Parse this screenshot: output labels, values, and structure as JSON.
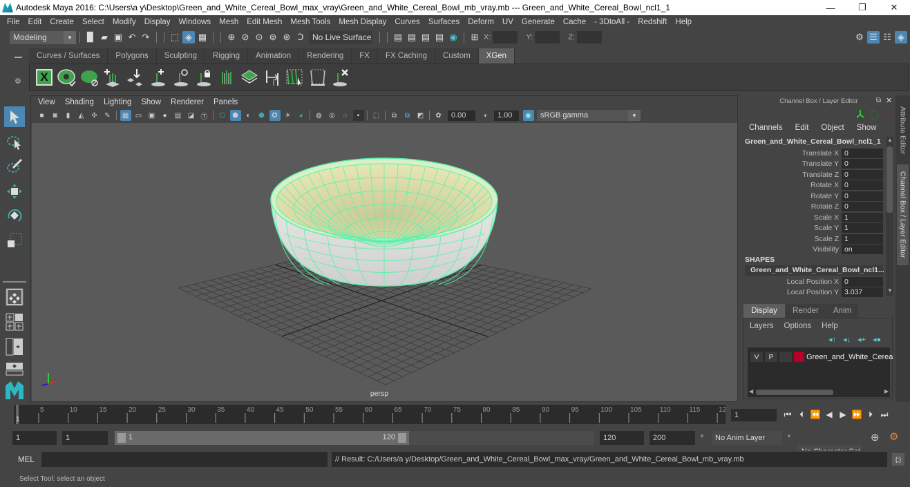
{
  "window": {
    "title": "Autodesk Maya 2016: C:\\Users\\a y\\Desktop\\Green_and_White_Cereal_Bowl_max_vray\\Green_and_White_Cereal_Bowl_mb_vray.mb   ---   Green_and_White_Cereal_Bowl_ncl1_1",
    "minimize": "—",
    "maximize": "❐",
    "close": "✕"
  },
  "menubar": [
    "File",
    "Edit",
    "Create",
    "Select",
    "Modify",
    "Display",
    "Windows",
    "Mesh",
    "Edit Mesh",
    "Mesh Tools",
    "Mesh Display",
    "Curves",
    "Surfaces",
    "Deform",
    "UV",
    "Generate",
    "Cache",
    "- 3DtoAll -",
    "Redshift",
    "Help"
  ],
  "statusline": {
    "mode": "Modeling",
    "live_surface": "No Live Surface",
    "x_label": "X:",
    "y_label": "Y:",
    "z_label": "Z:",
    "x_value": "",
    "y_value": "",
    "z_value": ""
  },
  "shelf": {
    "tabs": [
      "Curves / Surfaces",
      "Polygons",
      "Sculpting",
      "Rigging",
      "Animation",
      "Rendering",
      "FX",
      "FX Caching",
      "Custom",
      "XGen"
    ],
    "active_tab": "XGen",
    "icons": [
      "xgen-library-icon",
      "xgen-preview-icon",
      "xgen-clear-preview-icon",
      "add-guides-icon",
      "place-guides-icon",
      "add-modifier-icon",
      "show-guides-icon",
      "lock-guides-icon",
      "sculpt-guides-icon",
      "convert-to-polygons-icon",
      "rebuild-guides-icon",
      "select-guides-icon",
      "guide-tool-icon",
      "delete-guides-icon"
    ]
  },
  "panel": {
    "menu": [
      "View",
      "Shading",
      "Lighting",
      "Show",
      "Renderer",
      "Panels"
    ],
    "exposure": "0.00",
    "gamma": "1.00",
    "color_space": "sRGB gamma",
    "camera_label": "persp"
  },
  "channel_box": {
    "title": "Channel Box / Layer Editor",
    "menu": [
      "Channels",
      "Edit",
      "Object",
      "Show"
    ],
    "object_name": "Green_and_White_Cereal_Bowl_ncl1_1",
    "attributes": [
      {
        "label": "Translate X",
        "value": "0"
      },
      {
        "label": "Translate Y",
        "value": "0"
      },
      {
        "label": "Translate Z",
        "value": "0"
      },
      {
        "label": "Rotate X",
        "value": "0"
      },
      {
        "label": "Rotate Y",
        "value": "0"
      },
      {
        "label": "Rotate Z",
        "value": "0"
      },
      {
        "label": "Scale X",
        "value": "1"
      },
      {
        "label": "Scale Y",
        "value": "1"
      },
      {
        "label": "Scale Z",
        "value": "1"
      },
      {
        "label": "Visibility",
        "value": "on"
      }
    ],
    "shapes_header": "SHAPES",
    "shape_name": "Green_and_White_Cereal_Bowl_ncl1...",
    "shape_attributes": [
      {
        "label": "Local Position X",
        "value": "0"
      },
      {
        "label": "Local Position Y",
        "value": "3.037"
      }
    ]
  },
  "layer_editor": {
    "tabs": [
      "Display",
      "Render",
      "Anim"
    ],
    "active_tab": "Display",
    "menu": [
      "Layers",
      "Options",
      "Help"
    ],
    "layer": {
      "v": "V",
      "p": "P",
      "name": "Green_and_White_Cerea",
      "color": "#b5002a"
    }
  },
  "side_tabs": [
    "Attribute Editor",
    "Channel Box / Layer Editor"
  ],
  "timeline": {
    "ticks": [
      "5",
      "10",
      "15",
      "20",
      "25",
      "30",
      "35",
      "40",
      "45",
      "50",
      "55",
      "60",
      "65",
      "70",
      "75",
      "80",
      "85",
      "90",
      "95",
      "100",
      "105",
      "110",
      "115",
      "12"
    ],
    "current_frame_marker": "1",
    "current_frame": "1"
  },
  "range": {
    "start": "1",
    "playback_start": "1",
    "slider_start": "1",
    "slider_end": "120",
    "playback_end": "120",
    "end": "200",
    "anim_layer": "No Anim Layer",
    "character_set": "No Character Set"
  },
  "command": {
    "language": "MEL",
    "input": "",
    "result": "// Result: C:/Users/a y/Desktop/Green_and_White_Cereal_Bowl_max_vray/Green_and_White_Cereal_Bowl_mb_vray.mb"
  },
  "help_line": "Select Tool: select an object",
  "colors": {
    "accent": "#4b87b3",
    "wireframe": "#5ef0a8",
    "bg": "#444444"
  }
}
